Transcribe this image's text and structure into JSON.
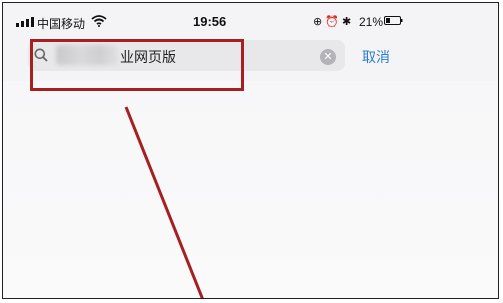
{
  "status_bar": {
    "carrier": "中国移动",
    "time": "19:56",
    "icons": "⊕ ⏰ ✱",
    "battery_percent": "21%"
  },
  "search": {
    "query_text": "业网页版",
    "cancel_label": "取消"
  },
  "icons": {
    "signal": "signal-bars-icon",
    "wifi": "wifi-icon",
    "search": "search-icon",
    "clear": "clear-icon",
    "battery": "battery-icon"
  },
  "colors": {
    "accent": "#2c7fce",
    "annotation": "#a52020",
    "search_bg": "#e8e8ea"
  }
}
